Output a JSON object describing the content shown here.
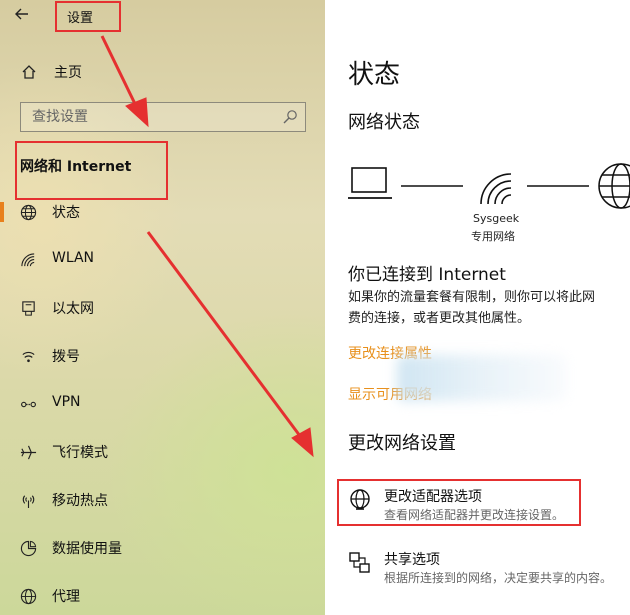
{
  "window": {
    "title": "设置",
    "back_label": "←"
  },
  "sidebar": {
    "home_label": "主页",
    "search_placeholder": "查找设置",
    "section_title": "网络和 Internet",
    "items": [
      {
        "label": "状态",
        "icon": "globe-icon",
        "active": true
      },
      {
        "label": "WLAN",
        "icon": "wifi-icon"
      },
      {
        "label": "以太网",
        "icon": "ethernet-icon"
      },
      {
        "label": "拨号",
        "icon": "dialup-icon"
      },
      {
        "label": "VPN",
        "icon": "vpn-icon"
      },
      {
        "label": "飞行模式",
        "icon": "airplane-icon"
      },
      {
        "label": "移动热点",
        "icon": "hotspot-icon"
      },
      {
        "label": "数据使用量",
        "icon": "data-usage-icon"
      },
      {
        "label": "代理",
        "icon": "globe-icon"
      }
    ]
  },
  "main": {
    "title": "状态",
    "network_status_heading": "网络状态",
    "network_name": "Sysgeek",
    "network_type": "专用网络",
    "connected_heading": "你已连接到 Internet",
    "connected_desc_line1": "如果你的流量套餐有限制，则你可以将此网",
    "connected_desc_line2": "费的连接，或者更改其他属性。",
    "link_change_props": "更改连接属性",
    "link_show": "显示可用网络",
    "change_settings_heading": "更改网络设置",
    "options": [
      {
        "title": "更改适配器选项",
        "desc": "查看网络适配器并更改连接设置。",
        "icon": "adapter-icon"
      },
      {
        "title": "共享选项",
        "desc": "根据所连接到的网络，决定要共享的内容。",
        "icon": "sharing-icon"
      }
    ]
  },
  "colors": {
    "accent": "#e8801c",
    "link": "#e8901c",
    "annotation": "#e53030"
  }
}
